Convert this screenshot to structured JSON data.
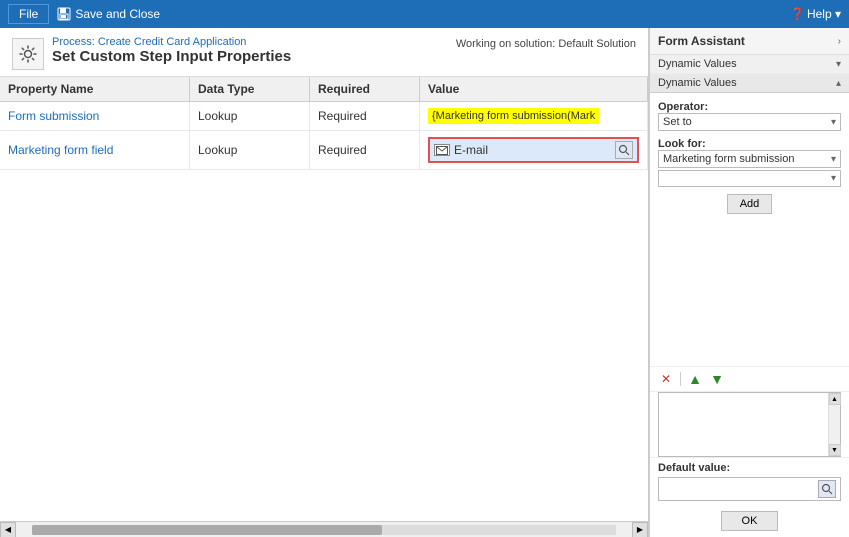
{
  "titlebar": {
    "file_label": "File",
    "save_close_label": "Save and Close",
    "help_label": "Help ▾"
  },
  "header": {
    "process_label": "Process: Create Credit Card Application",
    "page_title": "Set Custom Step Input Properties",
    "working_on": "Working on solution: Default Solution"
  },
  "table": {
    "columns": [
      "Property Name",
      "Data Type",
      "Required",
      "Value"
    ],
    "rows": [
      {
        "property": "Form submission",
        "data_type": "Lookup",
        "required": "Required",
        "value": "{Marketing form submission(Mark",
        "value_type": "yellow"
      },
      {
        "property": "Marketing form field",
        "data_type": "Lookup",
        "required": "Required",
        "value": "E-mail",
        "value_type": "email"
      }
    ]
  },
  "form_assistant": {
    "title": "Form Assistant",
    "chevron": "›",
    "dropdown1_label": "Dynamic Values",
    "dropdown1_chevron": "▾",
    "dynamic_values_label": "Dynamic Values",
    "dynamic_values_chevron": "▴",
    "operator_label": "Operator:",
    "operator_value": "Set to",
    "operator_placeholder": "Set to",
    "look_for_label": "Look for:",
    "look_for_value": "Marketing form submission",
    "look_for_sub_value": "",
    "add_button": "Add",
    "delete_icon": "✕",
    "up_icon": "▲",
    "down_icon": "▼",
    "default_value_label": "Default value:",
    "ok_button": "OK"
  }
}
